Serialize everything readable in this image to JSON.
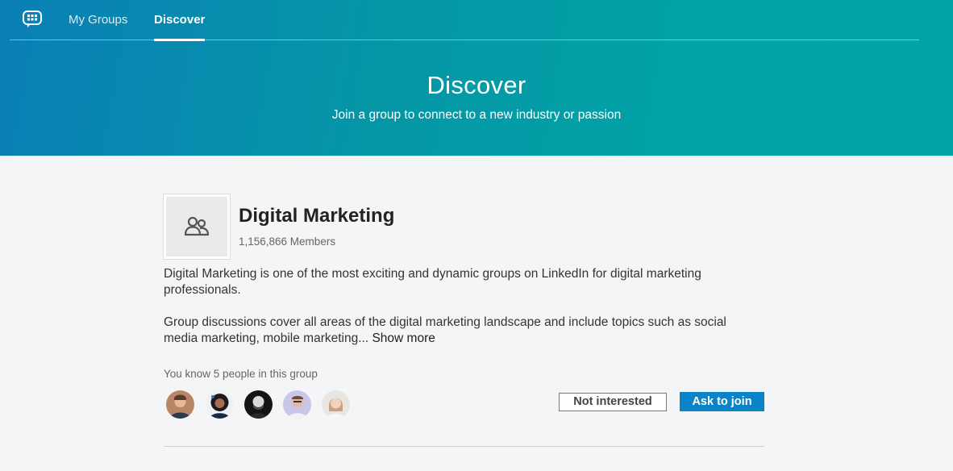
{
  "nav": {
    "tabs": [
      {
        "label": "My Groups",
        "active": false
      },
      {
        "label": "Discover",
        "active": true
      }
    ]
  },
  "hero": {
    "title": "Discover",
    "subtitle": "Join a group to connect to a new industry or passion"
  },
  "group": {
    "name": "Digital Marketing",
    "members": "1,156,866 Members",
    "description_1": "Digital Marketing is one of the most exciting and dynamic groups on LinkedIn for digital marketing professionals.",
    "description_2": "Group discussions cover all areas of the digital marketing landscape and include topics such as social media marketing, mobile marketing...",
    "show_more": "Show more",
    "you_know": "You know 5 people in this group",
    "not_interested_label": "Not interested",
    "ask_to_join_label": "Ask to join"
  },
  "colors": {
    "hero_gradient_start": "#0a7fb7",
    "hero_gradient_end": "#03a3a7",
    "primary_button": "#0a84c6"
  }
}
